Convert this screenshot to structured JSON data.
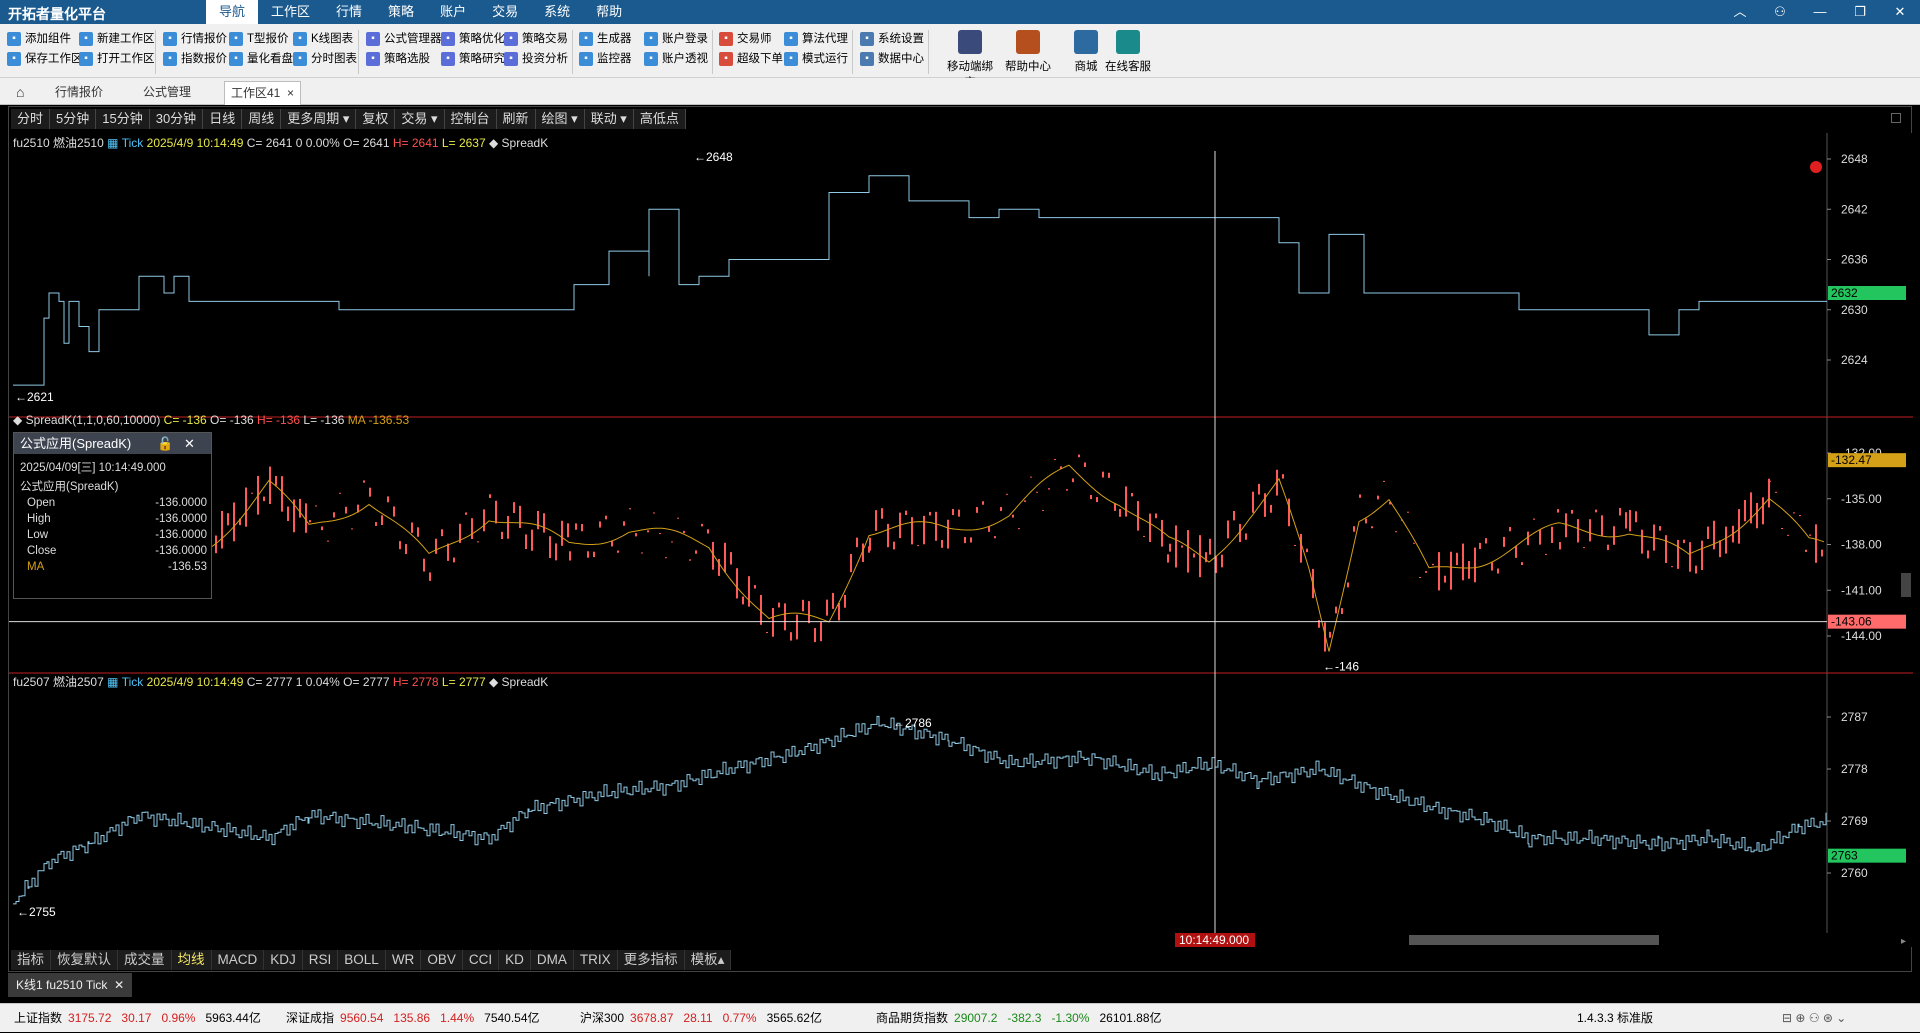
{
  "app": {
    "title": "开拓者量化平台",
    "menu": [
      "导航",
      "工作区",
      "行情",
      "策略",
      "账户",
      "交易",
      "系统",
      "帮助"
    ],
    "active_menu": "导航"
  },
  "ribbon": {
    "row1": [
      "添加组件",
      "新建工作区",
      "行情报价",
      "T型报价",
      "K线图表",
      "公式管理器",
      "策略优化",
      "策略交易",
      "生成器",
      "账户登录",
      "交易师",
      "算法代理",
      "系统设置"
    ],
    "row2": [
      "保存工作区",
      "打开工作区",
      "指数报价",
      "量化看盘",
      "分时图表",
      "策略选股",
      "策略研究",
      "投资分析",
      "监控器",
      "账户透视",
      "超级下单",
      "模式运行",
      "数据中心"
    ],
    "big": [
      "移动端绑定",
      "帮助中心",
      "商城",
      "在线客服"
    ]
  },
  "tabs": {
    "items": [
      "行情报价",
      "公式管理",
      "工作区41"
    ],
    "active": "工作区41"
  },
  "periodbar": [
    "分时",
    "5分钟",
    "15分钟",
    "30分钟",
    "日线",
    "周线",
    "更多周期 ▾",
    "复权",
    "交易 ▾",
    "控制台",
    "刷新",
    "绘图 ▾",
    "联动 ▾",
    "高低点"
  ],
  "bottombar": [
    "指标",
    "恢复默认",
    "成交量",
    "均线",
    "MACD",
    "KDJ",
    "RSI",
    "BOLL",
    "WR",
    "OBV",
    "CCI",
    "KD",
    "DMA",
    "TRIX",
    "更多指标",
    "模板▴"
  ],
  "panes": {
    "p1": {
      "symbol": "fu2510",
      "name": "燃油2510",
      "kind": "Tick",
      "datetime": "2025/4/9 10:14:49",
      "close": "C= 2641",
      "chg": "0",
      "pct": "0.00%",
      "open": "O= 2641",
      "high": "H= 2641",
      "low": "L= 2637",
      "ind": "SpreadK",
      "max_label": "2648",
      "min_label": "2621",
      "last_tag": "2632",
      "axis": [
        "2648",
        "2642",
        "2636",
        "2630",
        "2624"
      ]
    },
    "p2": {
      "title": "SpreadK(1,1,0,60,10000)",
      "close": "C= -136",
      "open": "O= -136",
      "high": "H= -136",
      "low": "L= -136",
      "ma": "MA -136.53",
      "min_label": "-146",
      "tag_ma": "-132.47",
      "tag_line": "-143.06",
      "axis": [
        "-132.00",
        "-135.00",
        "-138.00",
        "-141.00",
        "-144.00"
      ]
    },
    "p3": {
      "symbol": "fu2507",
      "name": "燃油2507",
      "kind": "Tick",
      "datetime": "2025/4/9 10:14:49",
      "close": "C= 2777",
      "chg": "1",
      "pct": "0.04%",
      "open": "O= 2777",
      "high": "H= 2778",
      "low": "L= 2777",
      "ind": "SpreadK",
      "max_label": "2786",
      "min_label": "2755",
      "last_tag": "2763",
      "axis": [
        "2787",
        "2778",
        "2769",
        "2760"
      ]
    }
  },
  "crosshair_time": "10:14:49.000",
  "popup": {
    "title": "公式应用(SpreadK)",
    "datetime": "2025/04/09[三] 10:14:49.000",
    "subtitle": "公式应用(SpreadK)",
    "rows": [
      {
        "label": "Open",
        "value": "-136.0000"
      },
      {
        "label": "High",
        "value": "-136.0000"
      },
      {
        "label": "Low",
        "value": "-136.0000"
      },
      {
        "label": "Close",
        "value": "-136.0000"
      },
      {
        "label": "MA",
        "value": "-136.53"
      }
    ]
  },
  "workspace_tab": "K线1 fu2510 Tick",
  "status": {
    "items": [
      {
        "name": "上证指数",
        "val": "3175.72",
        "chg": "30.17",
        "pct": "0.96%",
        "vol": "5963.44亿"
      },
      {
        "name": "深证成指",
        "val": "9560.54",
        "chg": "135.86",
        "pct": "1.44%",
        "vol": "7540.54亿"
      },
      {
        "name": "沪深300",
        "val": "3678.87",
        "chg": "28.11",
        "pct": "0.77%",
        "vol": "3565.62亿"
      },
      {
        "name": "商品期货指数",
        "val": "29007.2",
        "chg": "-382.3",
        "pct": "-1.30%",
        "vol": "26101.88亿"
      }
    ],
    "version": "1.4.3.3 标准版"
  },
  "colors": {
    "accent": "#1b5a8e",
    "price_line": "#8ec9e6",
    "candle": "#ff5a5a",
    "ma": "#d4a017",
    "green_tag": "#22c55e"
  }
}
